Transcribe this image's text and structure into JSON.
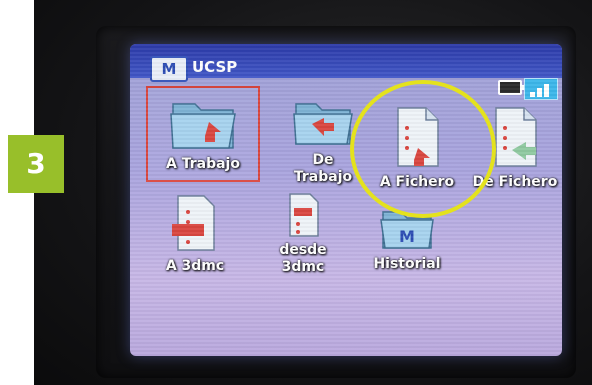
{
  "screen": {
    "menu_button": "M",
    "title": "UCSP"
  },
  "tiles": [
    {
      "label": "A Trabajo",
      "icon": "folder-import-icon",
      "selected": true
    },
    {
      "label": "De\nTrabajo",
      "icon": "folder-export-icon",
      "selected": false
    },
    {
      "label": "A Fichero",
      "icon": "file-import-icon",
      "selected": false
    },
    {
      "label": "De Fichero",
      "icon": "file-export-icon",
      "selected": false
    },
    {
      "label": "A 3dmc",
      "icon": "document-3dmc-import-icon",
      "selected": false
    },
    {
      "label": "desde\n3dmc",
      "icon": "document-3dmc-export-icon",
      "selected": false
    },
    {
      "label": "Historial",
      "icon": "history-folder-icon",
      "selected": false
    }
  ],
  "step_badge": "3",
  "colors": {
    "accent_highlight": "#e4e21d",
    "badge_green": "#98bf2a",
    "selection_red": "#d9463f"
  }
}
